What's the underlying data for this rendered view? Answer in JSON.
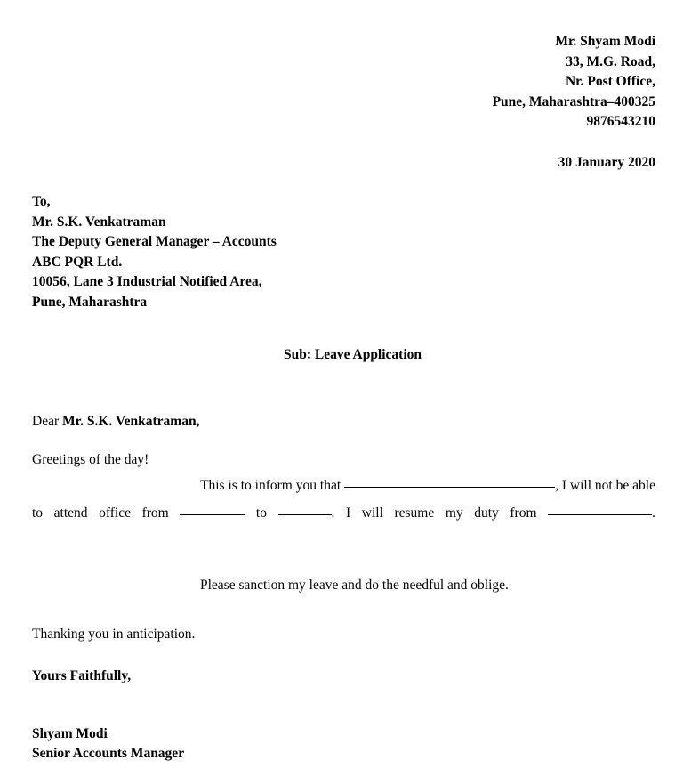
{
  "sender": {
    "lines": [
      "Mr. Shyam Modi",
      "33, M.G. Road,",
      "Nr. Post Office,",
      "Pune, Maharashtra–400325",
      "9876543210"
    ]
  },
  "date": "30 January 2020",
  "recipient": {
    "lines": [
      "To,",
      "Mr. S.K. Venkatraman",
      "The Deputy General Manager – Accounts",
      "ABC PQR Ltd.",
      "10056, Lane 3 Industrial Notified Area,",
      "Pune, Maharashtra"
    ]
  },
  "subject": "Sub: Leave Application",
  "salutation": {
    "prefix": "Dear ",
    "name": "Mr. S.K. Venkatraman,"
  },
  "body": {
    "greeting": "Greetings of the day!",
    "segment_1": "This is to inform you that ",
    "segment_2": ", I will not be able to attend office from ",
    "segment_3": " to ",
    "segment_4": ". I will resume my duty from ",
    "segment_5": ".",
    "please_line": "Please sanction my leave and do the needful and oblige."
  },
  "closing": {
    "thanking": "Thanking you in anticipation.",
    "yours": "Yours Faithfully,",
    "signature_name": "Shyam Modi",
    "signature_title": "Senior Accounts Manager"
  }
}
